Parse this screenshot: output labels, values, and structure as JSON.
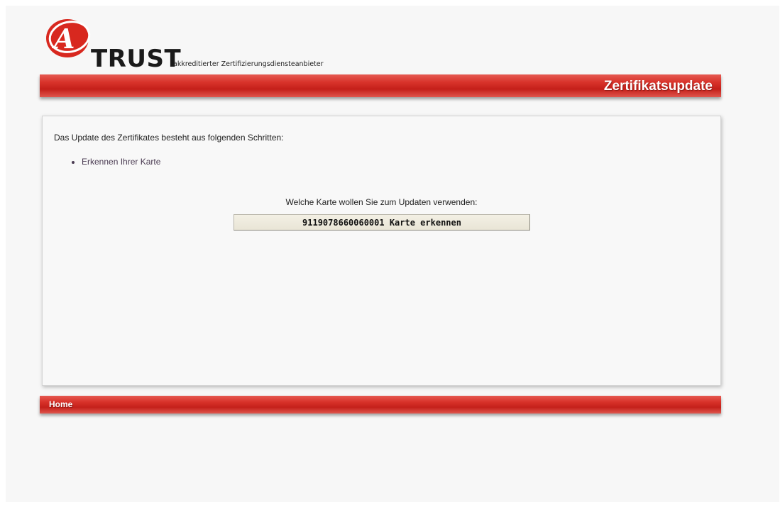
{
  "brand": {
    "logo_letter": "A",
    "name": "TRUST",
    "tagline": "akkreditierter Zertifizierungsdiensteanbieter",
    "color": "#d8281f"
  },
  "header": {
    "title": "Zertifikatsupdate"
  },
  "content": {
    "intro": "Das Update des Zertifikates besteht aus folgenden Schritten:",
    "steps": [
      "Erkennen Ihrer Karte"
    ],
    "question": "Welche Karte wollen Sie zum Updaten verwenden:",
    "card_button_label": "9119078660060001 Karte erkennen"
  },
  "footer": {
    "home_label": "Home"
  },
  "colors": {
    "accent_red": "#d8322a",
    "background": "#f7f7f7",
    "button_bg": "#f0ede1"
  }
}
